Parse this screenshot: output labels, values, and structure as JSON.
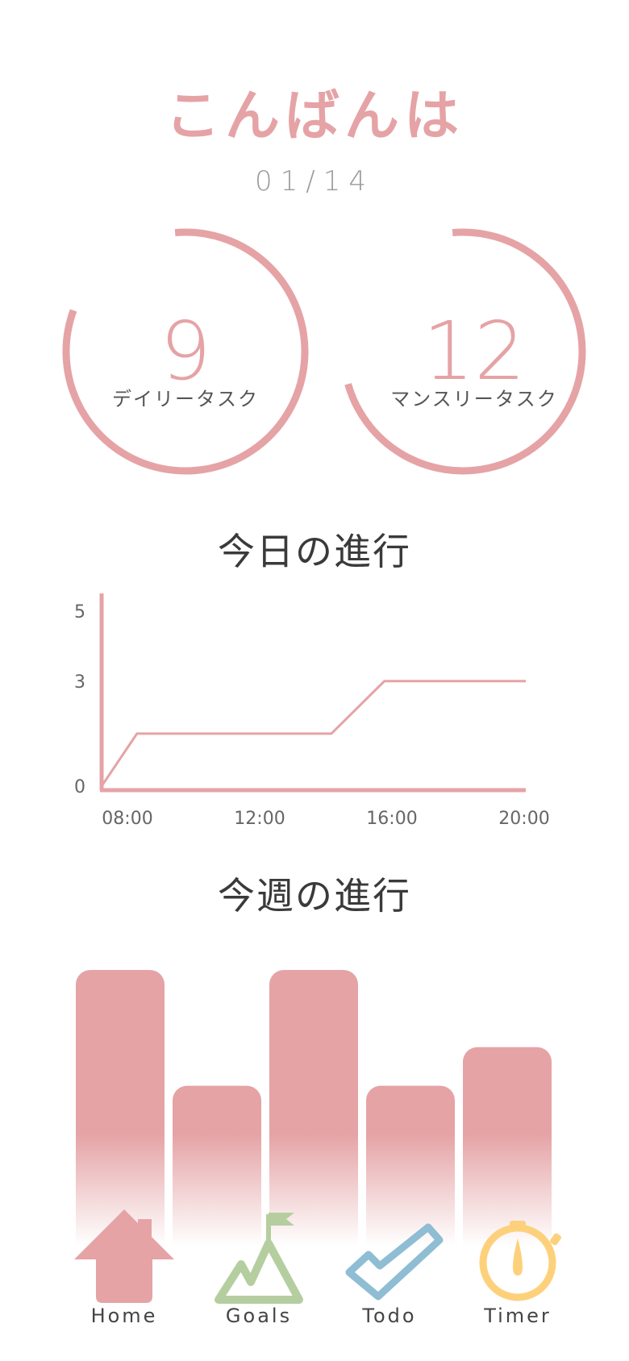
{
  "greeting": "こんばんは",
  "date": "01/14",
  "gauges": [
    {
      "value": "9",
      "label": "デイリータスク",
      "fraction": 0.82
    },
    {
      "value": "12",
      "label": "マンスリータスク",
      "fraction": 0.72
    }
  ],
  "today_title": "今日の進行",
  "week_title": "今週の進行",
  "colors": {
    "accent": "#e5a3a6",
    "goals": "#b5cea0",
    "todo": "#8fbdd3",
    "timer": "#fdd17c"
  },
  "chart_data": [
    {
      "type": "line",
      "title": "今日の進行",
      "x": [
        "08:00",
        "09:00",
        "14:30",
        "16:00",
        "20:00"
      ],
      "series": [
        {
          "values": [
            0,
            1.5,
            1.5,
            3,
            3
          ]
        }
      ],
      "x_ticks": [
        "08:00",
        "12:00",
        "16:00",
        "20:00"
      ],
      "y_ticks": [
        "0",
        "3",
        "5"
      ],
      "ylim": [
        0,
        5
      ]
    },
    {
      "type": "bar",
      "title": "今週の進行",
      "categories": [
        "",
        "",
        "",
        "",
        ""
      ],
      "values": [
        10,
        5.8,
        10,
        5.8,
        7.2
      ],
      "ylim": [
        0,
        10
      ]
    }
  ],
  "nav": [
    {
      "label": "Home",
      "icon": "home-icon"
    },
    {
      "label": "Goals",
      "icon": "mountain-flag-icon"
    },
    {
      "label": "Todo",
      "icon": "checkmark-icon"
    },
    {
      "label": "Timer",
      "icon": "stopwatch-icon"
    }
  ]
}
